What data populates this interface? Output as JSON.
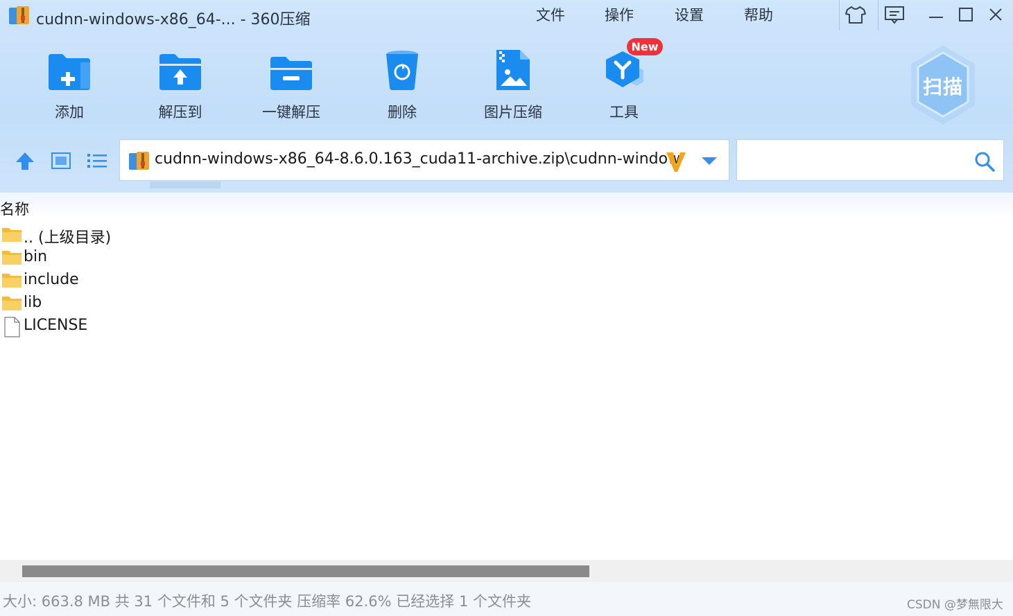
{
  "window": {
    "title": "cudnn-windows-x86_64-... - 360压缩"
  },
  "menu": [
    "文件",
    "操作",
    "设置",
    "帮助"
  ],
  "toolbar": {
    "items": [
      {
        "label": "添加",
        "icon": "folder-plus-icon"
      },
      {
        "label": "解压到",
        "icon": "folder-extract-icon"
      },
      {
        "label": "一键解压",
        "icon": "folder-one-click-icon"
      },
      {
        "label": "删除",
        "icon": "trash-icon"
      },
      {
        "label": "图片压缩",
        "icon": "image-compress-icon"
      },
      {
        "label": "工具",
        "icon": "tools-icon"
      }
    ],
    "new_badge": "New",
    "scan_label": "扫描"
  },
  "address": {
    "path": "cudnn-windows-x86_64-8.6.0.163_cuda11-archive.zip\\cudnn-window"
  },
  "search": {
    "placeholder": ""
  },
  "list": {
    "column_name": "名称",
    "rows": [
      {
        "name": ".. (上级目录)",
        "type": "folder"
      },
      {
        "name": "bin",
        "type": "folder"
      },
      {
        "name": "include",
        "type": "folder"
      },
      {
        "name": "lib",
        "type": "folder"
      },
      {
        "name": "LICENSE",
        "type": "file"
      }
    ]
  },
  "status": {
    "text": "大小: 663.8 MB 共 31 个文件和 5 个文件夹 压缩率 62.6% 已经选择 1 个文件夹",
    "watermark": "CSDN @梦無限大"
  },
  "colors": {
    "accent": "#1a8cf0",
    "toolbar_bg": "#c8e1fa",
    "badge_red": "#f2303a",
    "folder_yellow": "#f5c84c"
  }
}
